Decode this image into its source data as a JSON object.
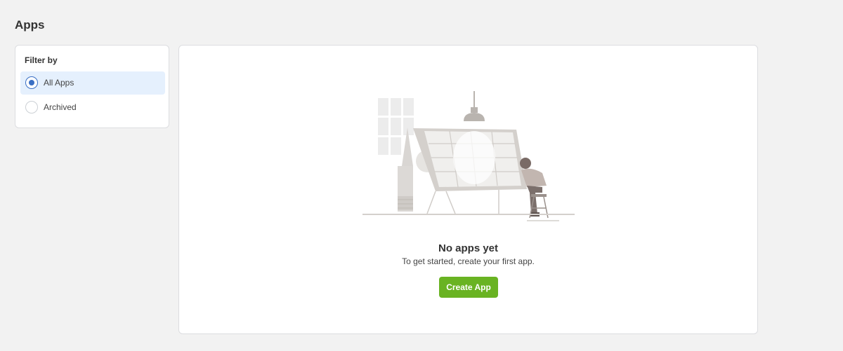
{
  "page": {
    "title": "Apps"
  },
  "filter": {
    "title": "Filter by",
    "options": [
      {
        "label": "All Apps",
        "selected": true
      },
      {
        "label": "Archived",
        "selected": false
      }
    ]
  },
  "empty_state": {
    "title": "No apps yet",
    "subtitle": "To get started, create your first app.",
    "button_label": "Create App"
  },
  "colors": {
    "accent_button": "#69b322",
    "selected_bg": "#e5f0fd",
    "radio_selected": "#3a6fc4"
  }
}
